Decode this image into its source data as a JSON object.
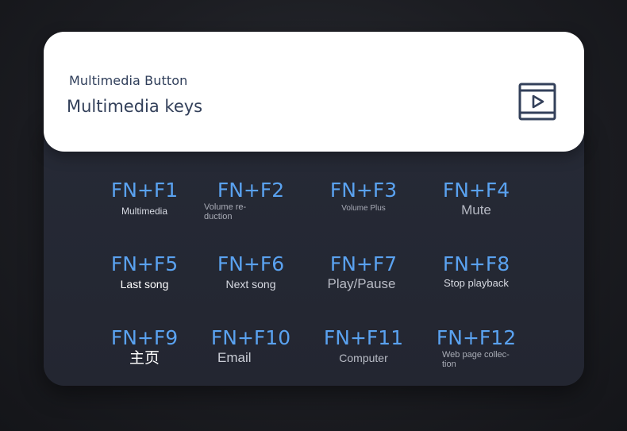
{
  "card": {
    "subtitle": "Multimedia Button",
    "title": "Multimedia keys",
    "icon": "play-video-icon",
    "icon_color": "#33405a"
  },
  "keys": [
    {
      "combo": "FN+F1",
      "label": "Multimedia"
    },
    {
      "combo": "FN+F2",
      "label": "Volume re-\nduction"
    },
    {
      "combo": "FN+F3",
      "label": "Volume Plus"
    },
    {
      "combo": "FN+F4",
      "label": "Mute"
    },
    {
      "combo": "FN+F5",
      "label": "Last song"
    },
    {
      "combo": "FN+F6",
      "label": "Next song"
    },
    {
      "combo": "FN+F7",
      "label": "Play/Pause"
    },
    {
      "combo": "FN+F8",
      "label": "Stop playback"
    },
    {
      "combo": "FN+F9",
      "label": "主页"
    },
    {
      "combo": "FN+F10",
      "label": "Email"
    },
    {
      "combo": "FN+F11",
      "label": "Computer"
    },
    {
      "combo": "FN+F12",
      "label": "Web page collec-\ntion"
    }
  ],
  "colors": {
    "accent": "#5aa2f0",
    "panel": "#252833",
    "card": "#ffffff"
  }
}
